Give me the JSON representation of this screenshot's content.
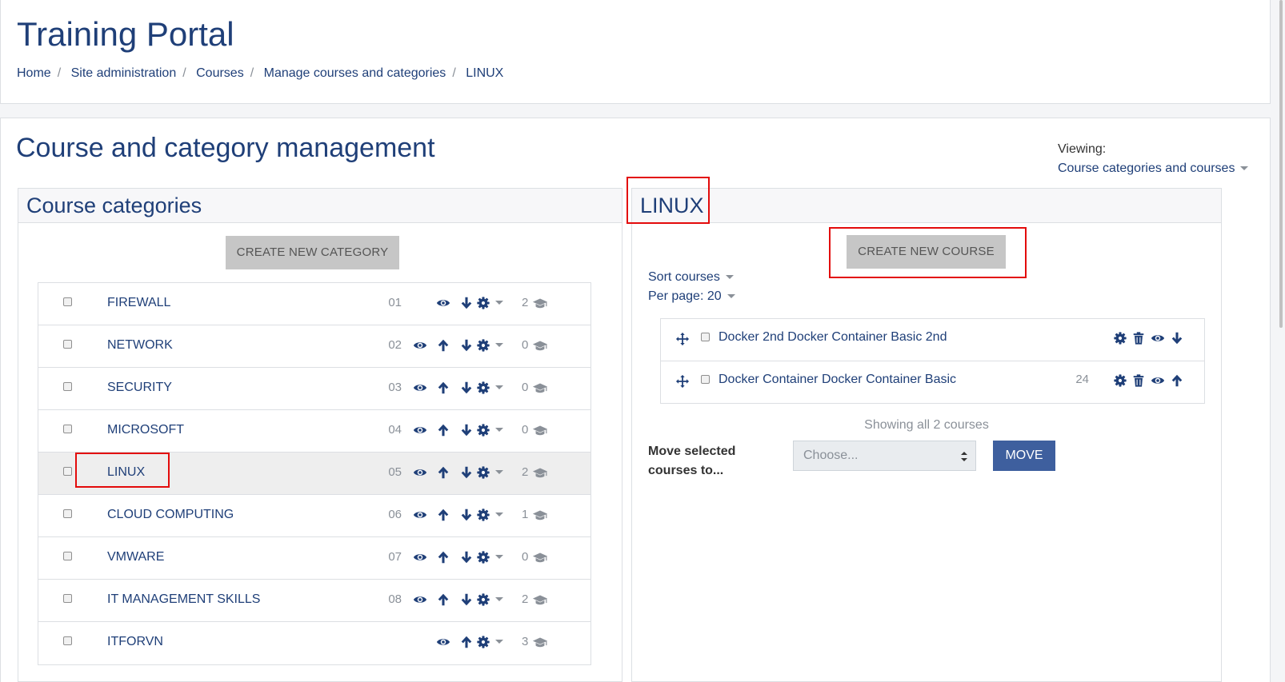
{
  "site": {
    "title": "Training Portal"
  },
  "breadcrumb": [
    {
      "label": "Home"
    },
    {
      "label": "Site administration"
    },
    {
      "label": "Courses"
    },
    {
      "label": "Manage courses and categories"
    },
    {
      "label": "LINUX"
    }
  ],
  "page": {
    "heading": "Course and category management",
    "viewing_label": "Viewing:",
    "viewing_value": "Course categories and courses"
  },
  "categories_panel": {
    "title": "Course categories",
    "create_button": "CREATE NEW CATEGORY",
    "items": [
      {
        "name": "FIREWALL",
        "idnumber": "01",
        "count": "2",
        "can_move_up": false,
        "can_move_down": true,
        "active": false
      },
      {
        "name": "NETWORK",
        "idnumber": "02",
        "count": "0",
        "can_move_up": true,
        "can_move_down": true,
        "active": false
      },
      {
        "name": "SECURITY",
        "idnumber": "03",
        "count": "0",
        "can_move_up": true,
        "can_move_down": true,
        "active": false
      },
      {
        "name": "MICROSOFT",
        "idnumber": "04",
        "count": "0",
        "can_move_up": true,
        "can_move_down": true,
        "active": false
      },
      {
        "name": "LINUX",
        "idnumber": "05",
        "count": "2",
        "can_move_up": true,
        "can_move_down": true,
        "active": true
      },
      {
        "name": "CLOUD COMPUTING",
        "idnumber": "06",
        "count": "1",
        "can_move_up": true,
        "can_move_down": true,
        "active": false
      },
      {
        "name": "VMWARE",
        "idnumber": "07",
        "count": "0",
        "can_move_up": true,
        "can_move_down": true,
        "active": false
      },
      {
        "name": "IT MANAGEMENT SKILLS",
        "idnumber": "08",
        "count": "2",
        "can_move_up": true,
        "can_move_down": true,
        "active": false
      },
      {
        "name": "ITFORVN",
        "idnumber": "",
        "count": "3",
        "can_move_up": true,
        "can_move_down": false,
        "active": false
      }
    ]
  },
  "courses_panel": {
    "title": "LINUX",
    "create_button": "CREATE NEW COURSE",
    "sort_label": "Sort courses",
    "per_page_label": "Per page: 20",
    "courses": [
      {
        "name": "Docker 2nd Docker Container Basic 2nd",
        "idnumber": "",
        "arrow": "down"
      },
      {
        "name": "Docker Container Docker Container Basic",
        "idnumber": "24",
        "arrow": "up"
      }
    ],
    "showing_text": "Showing all 2 courses",
    "move_label": "Move selected courses to...",
    "select_placeholder": "Choose...",
    "move_button": "MOVE"
  },
  "colors": {
    "link": "#1f3f78",
    "highlight": "#e30b0b",
    "primary_button": "#3e5f9e"
  },
  "icons": [
    "eye-icon",
    "arrow-up-icon",
    "arrow-down-icon",
    "gear-icon",
    "caret-down-icon",
    "graduation-cap-icon",
    "move-icon",
    "trash-icon"
  ]
}
